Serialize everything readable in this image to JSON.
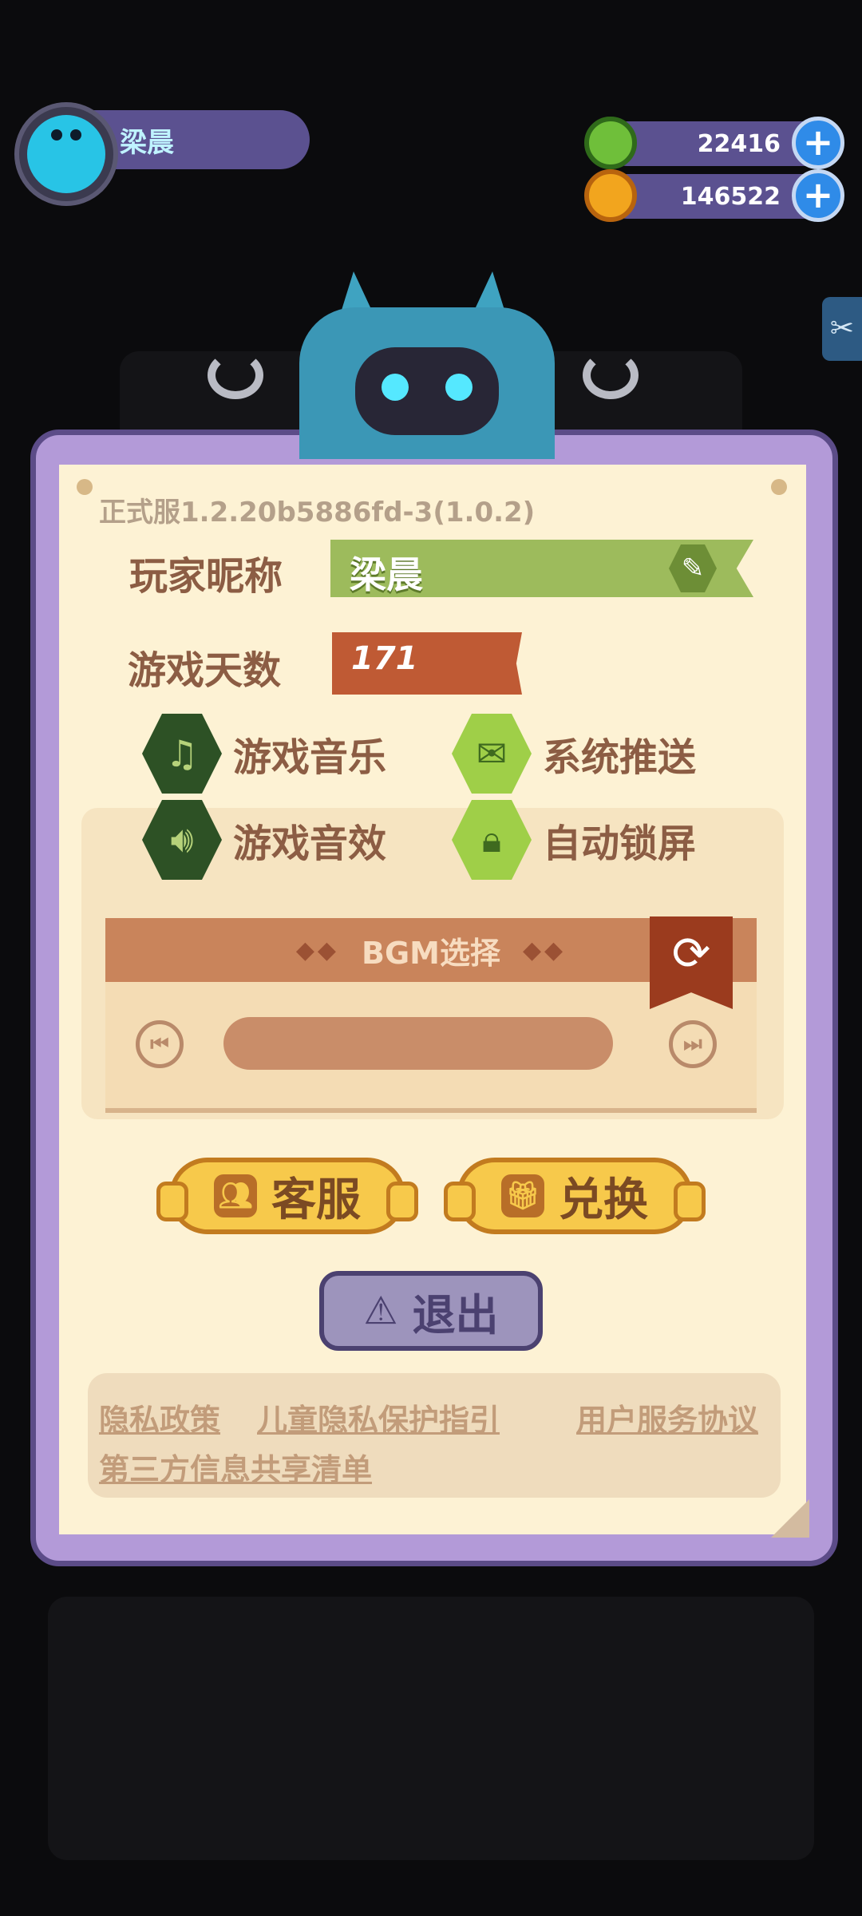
{
  "player": {
    "name": "梁晨"
  },
  "currencies": [
    {
      "name": "gem",
      "value": "22416",
      "color": "#6fbf3a"
    },
    {
      "name": "coin",
      "value": "146522",
      "color": "#f2a51e"
    }
  ],
  "settings": {
    "version": "正式服1.2.20b5886fd-3(1.0.2)",
    "nickname_label": "玩家昵称",
    "nickname_value": "梁晨",
    "days_label": "游戏天数",
    "days_value": "171",
    "toggles": [
      {
        "label": "游戏音乐",
        "icon": "music-note-icon",
        "on": false
      },
      {
        "label": "系统推送",
        "icon": "mail-icon",
        "on": true
      },
      {
        "label": "游戏音效",
        "icon": "speaker-icon",
        "on": false
      },
      {
        "label": "自动锁屏",
        "icon": "lock-icon",
        "on": true
      }
    ],
    "bgm": {
      "title": "BGM选择"
    },
    "buttons": {
      "support": "客服",
      "redeem": "兑换",
      "logout": "退出"
    },
    "links": [
      "隐私政策",
      "儿童隐私保护指引",
      "用户服务协议",
      "第三方信息共享清单"
    ]
  },
  "colors": {
    "accent": "#5b5190",
    "frame": "#b39ad8",
    "paper": "#fdf2d4",
    "gold": "#f7c94b"
  }
}
